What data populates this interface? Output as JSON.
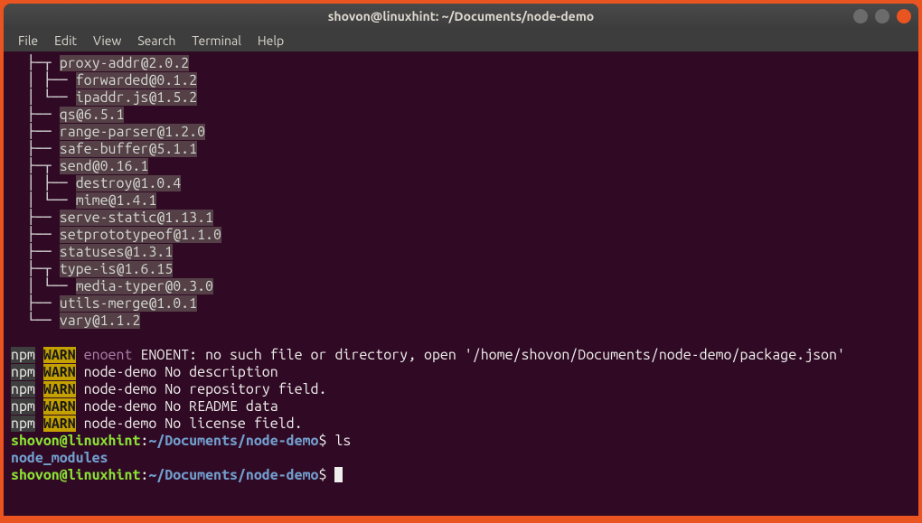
{
  "titlebar": {
    "title": "shovon@linuxhint: ~/Documents/node-demo"
  },
  "menubar": {
    "file": "File",
    "edit": "Edit",
    "view": "View",
    "search": "Search",
    "terminal": "Terminal",
    "help": "Help"
  },
  "tree": {
    "line0_branch": "  ├─┬ ",
    "line0_pkg": "proxy-addr@2.0.2",
    "line1_branch": "  │ ├── ",
    "line1_pkg": "forwarded@0.1.2",
    "line2_branch": "  │ └── ",
    "line2_pkg": "ipaddr.js@1.5.2",
    "line3_branch": "  ├── ",
    "line3_pkg": "qs@6.5.1",
    "line4_branch": "  ├── ",
    "line4_pkg": "range-parser@1.2.0",
    "line5_branch": "  ├── ",
    "line5_pkg": "safe-buffer@5.1.1",
    "line6_branch": "  ├─┬ ",
    "line6_pkg": "send@0.16.1",
    "line7_branch": "  │ ├── ",
    "line7_pkg": "destroy@1.0.4",
    "line8_branch": "  │ └── ",
    "line8_pkg": "mime@1.4.1",
    "line9_branch": "  ├── ",
    "line9_pkg": "serve-static@1.13.1",
    "line10_branch": "  ├── ",
    "line10_pkg": "setprototypeof@1.1.0",
    "line11_branch": "  ├── ",
    "line11_pkg": "statuses@1.3.1",
    "line12_branch": "  ├─┬ ",
    "line12_pkg": "type-is@1.6.15",
    "line13_branch": "  │ └── ",
    "line13_pkg": "media-typer@0.3.0",
    "line14_branch": "  ├── ",
    "line14_pkg": "utils-merge@1.0.1",
    "line15_branch": "  └── ",
    "line15_pkg": "vary@1.1.2"
  },
  "npm": {
    "npm": "npm",
    "warn": "WARN",
    "enoent": "enoent",
    "msg0": " ENOENT: no such file or directory, open '/home/shovon/Documents/node-demo/package.json'",
    "msg1": " node-demo No description",
    "msg2": " node-demo No repository field.",
    "msg3": " node-demo No README data",
    "msg4": " node-demo No license field."
  },
  "prompt": {
    "user": "shovon@linuxhint",
    "colon": ":",
    "path": "~/Documents/node-demo",
    "dollar": "$ ",
    "cmd_ls": "ls"
  },
  "output": {
    "node_modules": "node_modules"
  }
}
